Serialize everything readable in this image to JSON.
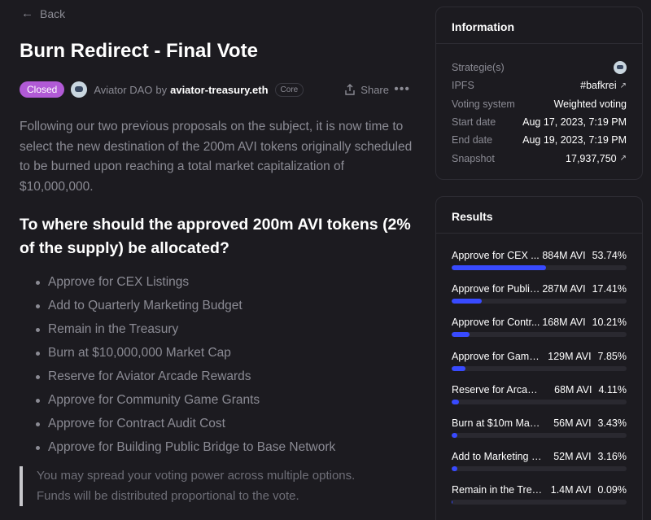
{
  "nav": {
    "back_label": "Back"
  },
  "proposal": {
    "title": "Burn Redirect - Final Vote",
    "state": "Closed",
    "space": "Aviator DAO",
    "by": "by",
    "author": "aviator-treasury.eth",
    "author_badge": "Core",
    "share_label": "Share",
    "more_label": "•••",
    "intro": "Following our two previous proposals on the subject, it is now time to select the new destination of the 200m AVI tokens originally scheduled to be burned upon reaching a total market capitalization of $10,000,000.",
    "question": "To where should the approved 200m AVI tokens (2% of the supply) be allocated?",
    "options": [
      "Approve for CEX Listings",
      "Add to Quarterly Marketing Budget",
      "Remain in the Treasury",
      "Burn at $10,000,000 Market Cap",
      "Reserve for Aviator Arcade Rewards",
      "Approve for Community Game Grants",
      "Approve for Contract Audit Cost",
      "Approve for Building Public Bridge to Base Network"
    ],
    "note_line1": "You may spread your voting power across multiple options.",
    "note_line2": "Funds will be distributed proportional to the vote."
  },
  "information": {
    "title": "Information",
    "strategies_label": "Strategie(s)",
    "ipfs_label": "IPFS",
    "ipfs_value": "#bafkrei",
    "voting_system_label": "Voting system",
    "voting_system_value": "Weighted voting",
    "start_label": "Start date",
    "start_value": "Aug 17, 2023, 7:19 PM",
    "end_label": "End date",
    "end_value": "Aug 19, 2023, 7:19 PM",
    "snapshot_label": "Snapshot",
    "snapshot_value": "17,937,750"
  },
  "results": {
    "title": "Results",
    "items": [
      {
        "choice": "Approve for CEX ...",
        "count": "884M AVI",
        "pct": "53.74%",
        "fraction": 0.5374
      },
      {
        "choice": "Approve for Public...",
        "count": "287M AVI",
        "pct": "17.41%",
        "fraction": 0.1741
      },
      {
        "choice": "Approve for Contr...",
        "count": "168M AVI",
        "pct": "10.21%",
        "fraction": 0.1021
      },
      {
        "choice": "Approve for Game ...",
        "count": "129M AVI",
        "pct": "7.85%",
        "fraction": 0.0785
      },
      {
        "choice": "Reserve for Arcade R...",
        "count": "68M AVI",
        "pct": "4.11%",
        "fraction": 0.0411
      },
      {
        "choice": "Burn at $10m Marke...",
        "count": "56M AVI",
        "pct": "3.43%",
        "fraction": 0.0343
      },
      {
        "choice": "Add to Marketing Bu...",
        "count": "52M AVI",
        "pct": "3.16%",
        "fraction": 0.0316
      },
      {
        "choice": "Remain in the Treas...",
        "count": "1.4M AVI",
        "pct": "0.09%",
        "fraction": 0.0009
      }
    ]
  },
  "colors": {
    "accent": "#384aff",
    "closed_badge": "#b15ad6",
    "background": "#1c1b20"
  }
}
